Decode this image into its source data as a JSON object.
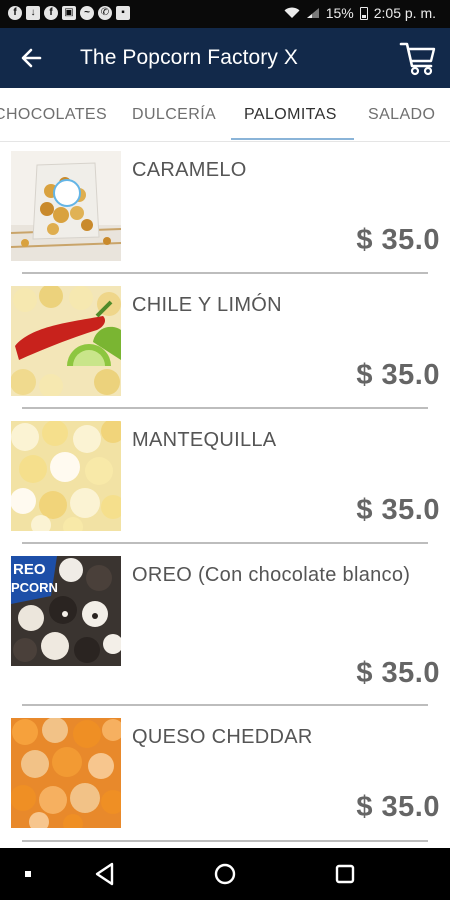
{
  "status_bar": {
    "battery": "15%",
    "time": "2:05 p. m.",
    "notification_icons": [
      "facebook-icon",
      "download-icon",
      "facebook-icon",
      "image-icon",
      "messenger-icon",
      "whatsapp-icon",
      "save-icon"
    ]
  },
  "header": {
    "title": "The Popcorn Factory X",
    "back_icon": "arrow-left-icon",
    "cart_icon": "shopping-cart-icon",
    "background": "#12294a"
  },
  "tabs": [
    {
      "label": "CHOCOLATES",
      "active": false
    },
    {
      "label": "DULCERÍA",
      "active": false
    },
    {
      "label": "PALOMITAS",
      "active": true
    },
    {
      "label": "SALADO",
      "active": false
    }
  ],
  "products": [
    {
      "name": "CARAMELO",
      "price": "$ 35.0",
      "image": "caramel-popcorn-bag"
    },
    {
      "name": "CHILE Y LIMÓN",
      "price": "$ 35.0",
      "image": "chili-lime-popcorn"
    },
    {
      "name": "MANTEQUILLA",
      "price": "$ 35.0",
      "image": "butter-popcorn"
    },
    {
      "name": "OREO (Con chocolate blanco)",
      "price": "$ 35.0",
      "image": "oreo-popcorn"
    },
    {
      "name": "QUESO CHEDDAR",
      "price": "$ 35.0",
      "image": "cheddar-popcorn"
    }
  ],
  "nav_bar": {
    "items": [
      "dot-icon",
      "back-triangle-icon",
      "home-circle-icon",
      "recents-square-icon"
    ]
  }
}
